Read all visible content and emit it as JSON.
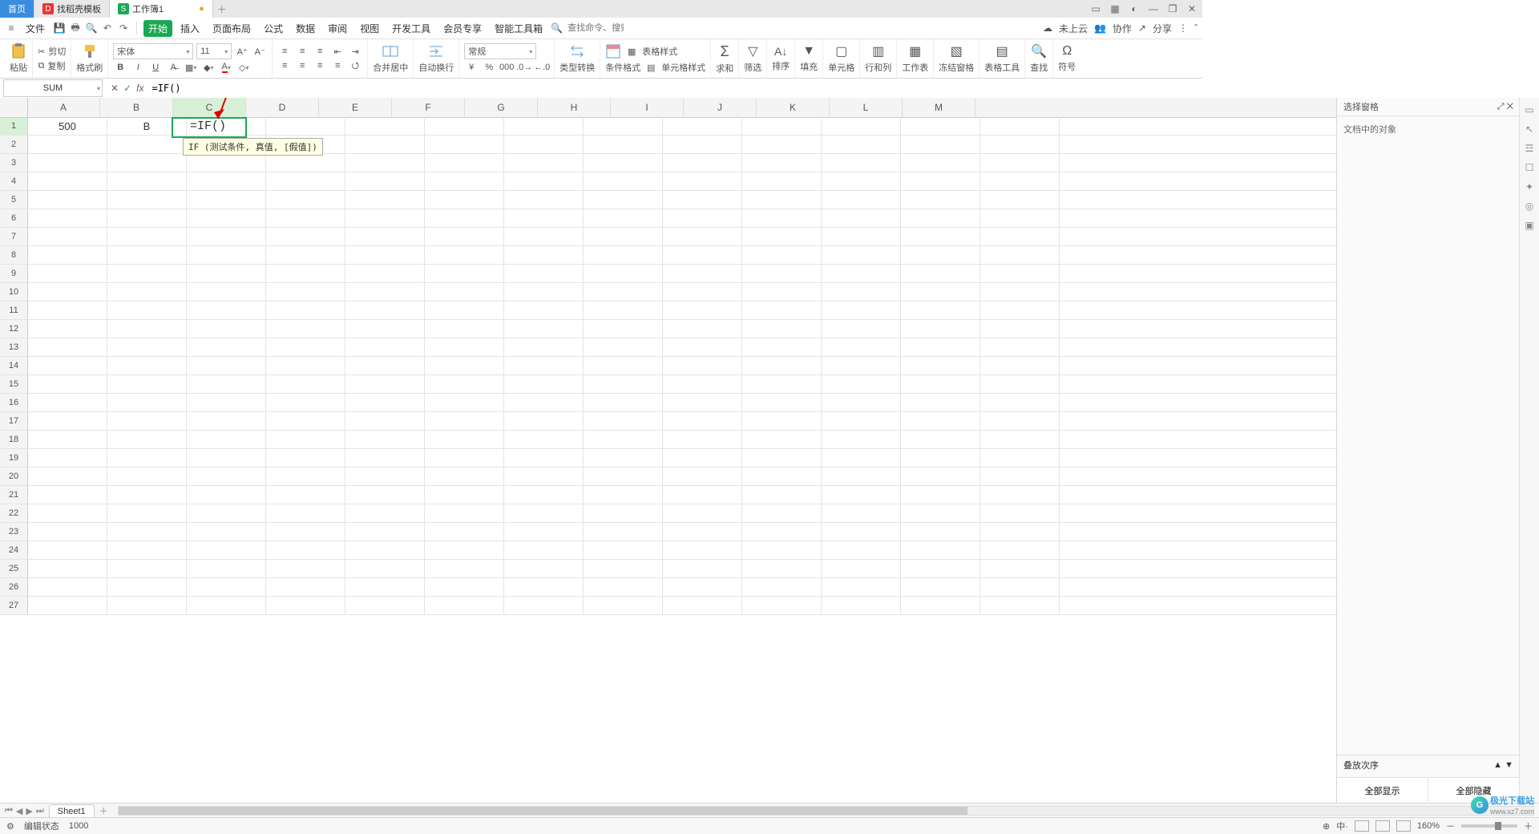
{
  "tabs": {
    "home": "首页",
    "template": "找稻壳模板",
    "workbook": "工作簿1",
    "dirty": "●"
  },
  "window_icons": [
    "▭",
    "⊞",
    "◐",
    "—",
    "❐",
    "✕"
  ],
  "menubar": {
    "file": "文件",
    "items": [
      "开始",
      "插入",
      "页面布局",
      "公式",
      "数据",
      "审阅",
      "视图",
      "开发工具",
      "会员专享",
      "智能工具箱"
    ],
    "search_hint": "查找命令、搜索模板",
    "search_prefix": "Q 查找命令、",
    "right": {
      "cloud": "未上云",
      "coop": "协作",
      "share": "分享"
    }
  },
  "ribbon": {
    "paste": "粘贴",
    "cut": "剪切",
    "copy": "复制",
    "brush": "格式刷",
    "font_name": "宋体",
    "font_size": "11",
    "merge": "合并居中",
    "wrap": "自动换行",
    "number_format": "常规",
    "type_conv": "类型转换",
    "cond_fmt": "条件格式",
    "table_style": "表格样式",
    "cell_style": "单元格样式",
    "sum": "求和",
    "filter": "筛选",
    "sort": "排序",
    "fill": "填充",
    "cell": "单元格",
    "rowcol": "行和列",
    "sheet": "工作表",
    "freeze": "冻结窗格",
    "table_tool": "表格工具",
    "find": "查找",
    "symbol": "符号"
  },
  "fx": {
    "name_box": "SUM",
    "formula": "=IF()"
  },
  "columns": [
    "A",
    "B",
    "C",
    "D",
    "E",
    "F",
    "G",
    "H",
    "I",
    "J",
    "K",
    "L",
    "M"
  ],
  "row_count": 27,
  "active_col_index": 2,
  "active_row": 1,
  "cells": {
    "A1": "500",
    "B1": "B",
    "C1": "=IF()"
  },
  "tooltip": "IF (测试条件, 真值, [假值])",
  "panel": {
    "title": "选择窗格",
    "body": "文档中的对象",
    "stack": "叠放次序",
    "show_all": "全部显示",
    "hide_all": "全部隐藏"
  },
  "sheet": {
    "name": "Sheet1"
  },
  "status": {
    "mode": "编辑状态",
    "count": "1000",
    "zoom": "160%"
  },
  "watermark": "极光下载站",
  "watermark_sub": "www.xz7.com"
}
